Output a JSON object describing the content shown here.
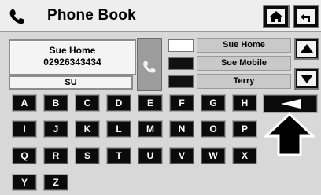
{
  "header": {
    "title": "Phone Book"
  },
  "icons": {
    "handset": "phone-handset-icon",
    "home": "home-icon",
    "back": "back-arrow-icon",
    "scroll_up": "up-triangle-icon",
    "scroll_down": "down-triangle-icon",
    "delete": "left-triangle-icon"
  },
  "contact": {
    "name": "Sue Home",
    "number": "02926343434"
  },
  "search": {
    "value": "SU"
  },
  "results": [
    {
      "label": "Sue Home"
    },
    {
      "label": "Sue Mobile"
    },
    {
      "label": "Terry"
    }
  ],
  "keyboard": {
    "row1": [
      "A",
      "B",
      "C",
      "D",
      "E",
      "F",
      "G",
      "H"
    ],
    "row2": [
      "I",
      "J",
      "K",
      "L",
      "M",
      "N",
      "O",
      "P"
    ],
    "row3": [
      "Q",
      "R",
      "S",
      "T",
      "U",
      "V",
      "W",
      "X"
    ],
    "row4": [
      "Y",
      "Z"
    ]
  },
  "colors": {
    "key_bg": "#0b0b0b",
    "key_text": "#ffffff",
    "screen_bg": "#d8d8d8",
    "list_bg": "#c9c9c9"
  }
}
